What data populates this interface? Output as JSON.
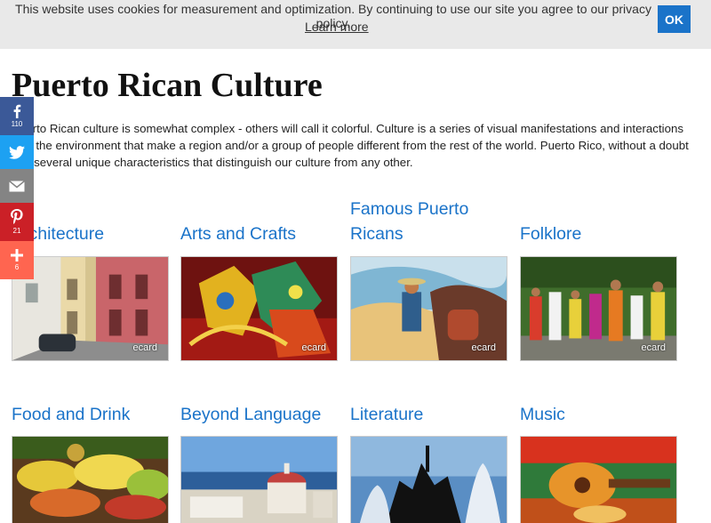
{
  "cookie": {
    "text": "This website uses cookies for measurement and optimization. By continuing to use our site you agree to our privacy policy.",
    "learn_more": "Learn more",
    "ok": "OK"
  },
  "page": {
    "title": "Puerto Rican Culture",
    "intro": "Puerto Rican culture is somewhat complex - others will call it colorful. Culture is a series of visual manifestations and interactions with the environment that make a region and/or a group of people different from the rest of the world. Puerto Rico, without a doubt has several unique characteristics that distinguish our culture from any other."
  },
  "share": {
    "facebook": {
      "icon": "facebook-icon",
      "count": "110"
    },
    "twitter": {
      "icon": "twitter-icon"
    },
    "email": {
      "icon": "email-icon"
    },
    "pinterest": {
      "icon": "pinterest-icon",
      "count": "21"
    },
    "more": {
      "icon": "plus-icon",
      "count": "6"
    }
  },
  "categories": [
    {
      "title": "Architecture",
      "ecard": "ecard"
    },
    {
      "title": "Arts and Crafts",
      "ecard": "ecard"
    },
    {
      "title": "Famous Puerto Ricans",
      "ecard": "ecard"
    },
    {
      "title": "Folklore",
      "ecard": "ecard"
    },
    {
      "title": "Food and Drink"
    },
    {
      "title": "Beyond Language"
    },
    {
      "title": "Literature"
    },
    {
      "title": "Music"
    }
  ]
}
